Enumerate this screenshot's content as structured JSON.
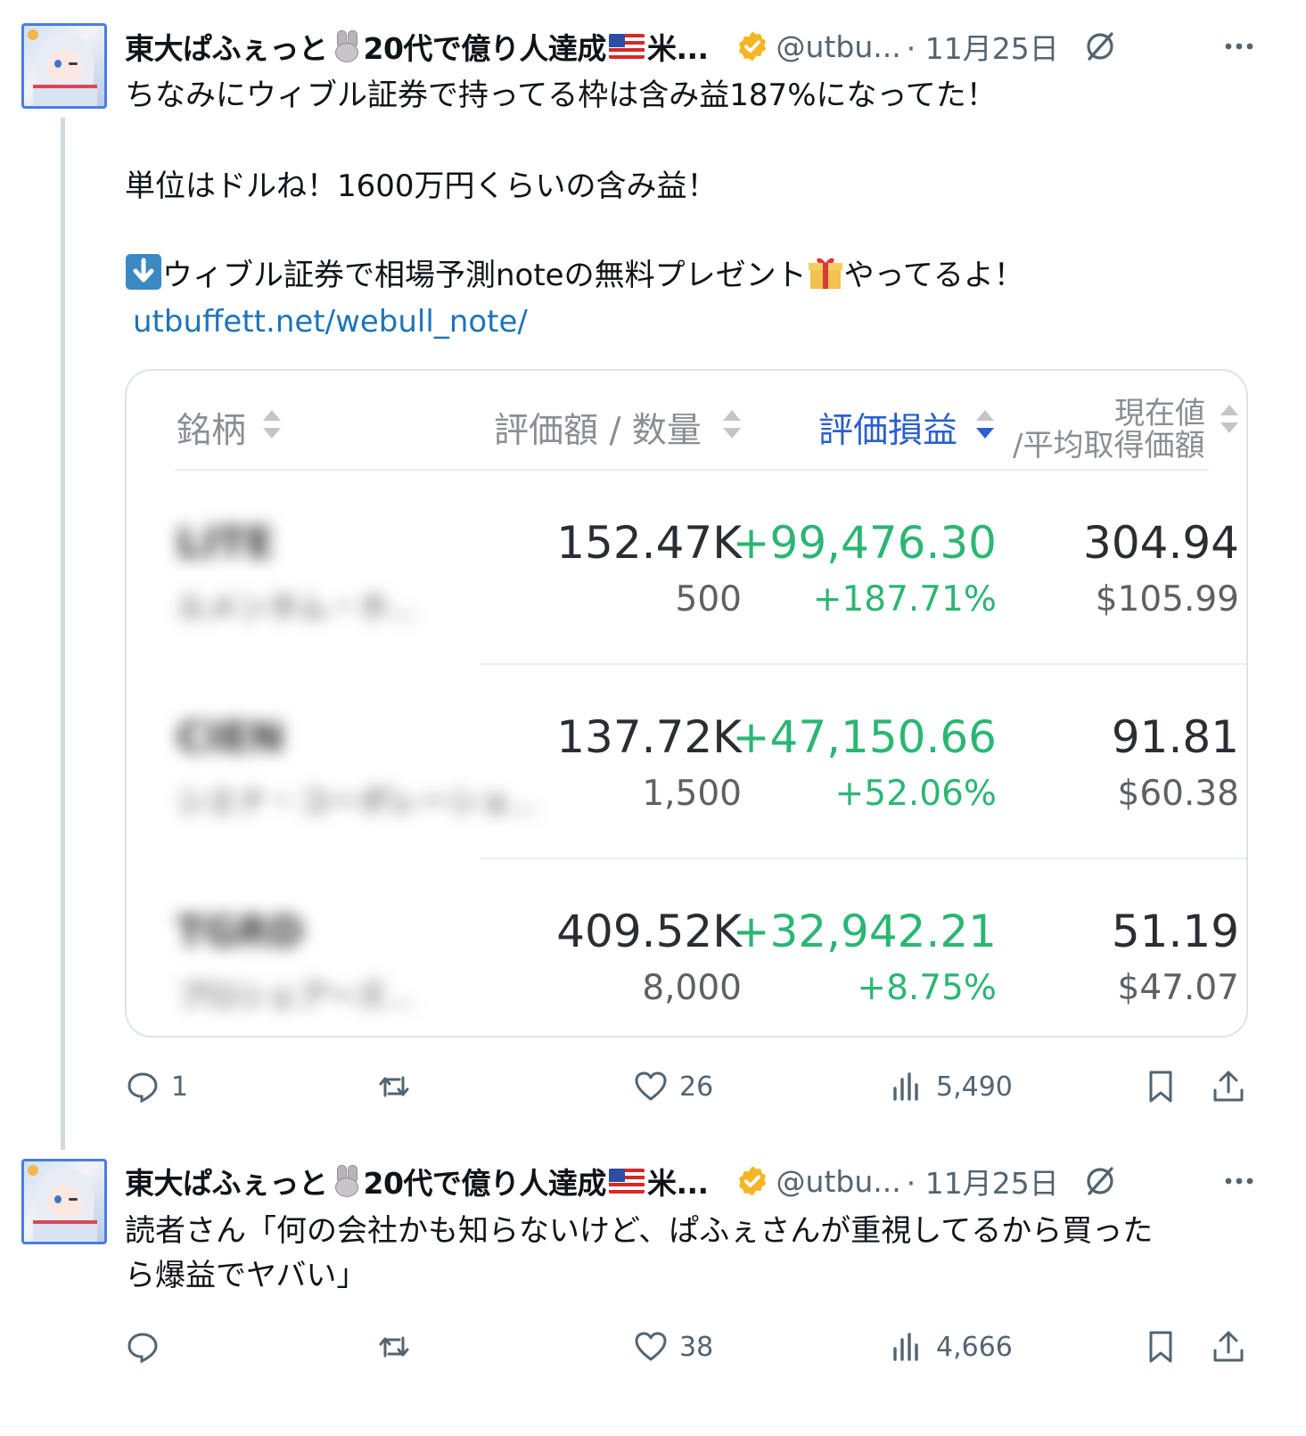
{
  "tweets": [
    {
      "author_name": "東大ぱふぇっと",
      "author_name_mid": "20代で億り人達成",
      "author_name_tail": "米...",
      "handle": "@utbu...",
      "date": "· 11月25日",
      "text_line1": "ちなみにウィブル証券で持ってる枠は含み益187%になってた！",
      "text_line2": "単位はドルね！1600万円くらいの含み益！",
      "text_line3_a": "ウィブル証券で相場予測noteの無料プレゼント",
      "text_line3_b": "やってるよ！",
      "link": "utbuffett.net/webull_note/",
      "reply_count": "1",
      "retweet_count": "",
      "like_count": "26",
      "view_count": "5,490"
    },
    {
      "author_name": "東大ぱふぇっと",
      "author_name_mid": "20代で億り人達成",
      "author_name_tail": "米...",
      "handle": "@utbu...",
      "date": "· 11月25日",
      "text_line1": "読者さん「何の会社かも知らないけど、ぱふぇさんが重視してるから買った",
      "text_line2": "ら爆益でヤバい」",
      "reply_count": "",
      "retweet_count": "",
      "like_count": "38",
      "view_count": "4,666"
    }
  ],
  "holdings_table": {
    "columns": {
      "ticker": "銘柄",
      "value_qty": "評価額 / 数量",
      "pnl": "評価損益",
      "price_line1": "現在値",
      "price_line2": "/平均取得価額"
    },
    "rows": [
      {
        "ticker_blurred": "LITE",
        "name_blurred": "ルメンタム・ホ...",
        "value": "152.47K",
        "qty": "500",
        "pnl": "+99,476.30",
        "pnl_pct": "+187.71%",
        "price": "304.94",
        "avg_cost": "$105.99"
      },
      {
        "ticker_blurred": "CIEN",
        "name_blurred": "シエナ・コーポレーショ...",
        "value": "137.72K",
        "qty": "1,500",
        "pnl": "+47,150.66",
        "pnl_pct": "+52.06%",
        "price": "91.81",
        "avg_cost": "$60.38"
      },
      {
        "ticker_blurred": "TGRD",
        "name_blurred": "プロシェアーズ...",
        "value": "409.52K",
        "qty": "8,000",
        "pnl": "+32,942.21",
        "pnl_pct": "+8.75%",
        "price": "51.19",
        "avg_cost": "$47.07"
      }
    ]
  },
  "colors": {
    "gain_green": "#2bb673",
    "active_sort_blue": "#2a5fd0",
    "link_blue": "#1d74b9",
    "verified_gold": "#f4b625"
  }
}
